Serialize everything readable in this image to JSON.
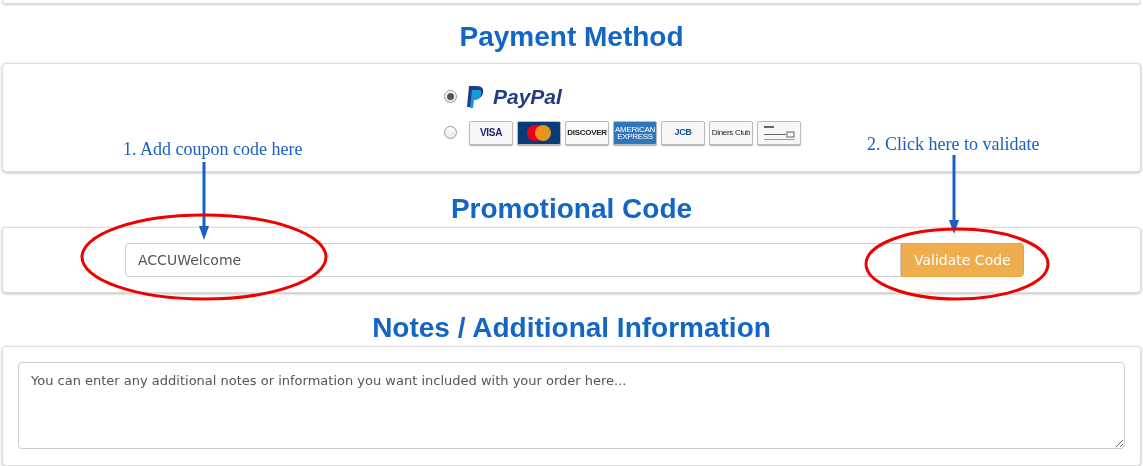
{
  "payment": {
    "heading": "Payment Method",
    "options": [
      {
        "kind": "paypal",
        "label": "PayPal",
        "selected": true
      },
      {
        "kind": "cards",
        "selected": false,
        "cards": [
          {
            "kind": "visa",
            "label": "VISA"
          },
          {
            "kind": "mastercard"
          },
          {
            "kind": "discover",
            "label": "DISCOVER"
          },
          {
            "kind": "amex",
            "label": "AMERICAN EXPRESS"
          },
          {
            "kind": "jcb",
            "label": "JCB"
          },
          {
            "kind": "diners",
            "label": "Diners Club"
          },
          {
            "kind": "check"
          }
        ]
      }
    ]
  },
  "promo": {
    "heading": "Promotional Code",
    "value": "ACCUWelcome",
    "button": "Validate Code"
  },
  "notes": {
    "heading": "Notes / Additional Information",
    "placeholder": "You can enter any additional notes or information you want included with your order here..."
  },
  "annotations": [
    {
      "text": "1. Add coupon code here"
    },
    {
      "text": "2. Click here to validate"
    }
  ]
}
